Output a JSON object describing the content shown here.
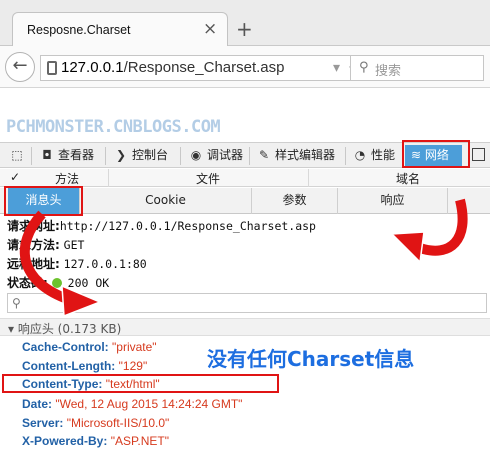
{
  "browser": {
    "tab_title": "Resposne.Charset",
    "tab_close": "×",
    "new_tab": "+",
    "url_host": "127.0.0.1",
    "url_path": "/Response_Charset.asp",
    "search_placeholder": "搜索",
    "go_label": "→"
  },
  "watermark": "PCHMONSTER.CNBLOGS.COM",
  "devtools": {
    "tools": [
      "查看器",
      "控制台",
      "调试器",
      "样式编辑器",
      "性能",
      "网络"
    ],
    "columns": [
      "方法",
      "文件",
      "域名"
    ],
    "detail_tabs": [
      "消息头",
      "Cookie",
      "参数",
      "响应"
    ],
    "request": {
      "url_label": "请求网址:",
      "url_value": "http://127.0.0.1/Response_Charset.asp",
      "method_label": "请求方法:",
      "method_value": "GET",
      "remote_label": "远程地址:",
      "remote_value": "127.0.0.1:80",
      "status_label": "状态码:",
      "status_value": "200 OK"
    },
    "response_headers_title": "响应头 (0.173 KB)",
    "headers": [
      {
        "name": "Cache-Control:",
        "value": "\"private\""
      },
      {
        "name": "Content-Length:",
        "value": "\"129\""
      },
      {
        "name": "Content-Type:",
        "value": "\"text/html\""
      },
      {
        "name": "Date:",
        "value": "\"Wed, 12 Aug 2015 14:24:24 GMT\""
      },
      {
        "name": "Server:",
        "value": "\"Microsoft-IIS/10.0\""
      },
      {
        "name": "X-Powered-By:",
        "value": "\"ASP.NET\""
      }
    ]
  },
  "annotation": "没有任何Charset信息",
  "colors": {
    "accent": "#4c9ed9",
    "highlight": "#e01414",
    "annotation": "#1d6ee0"
  }
}
